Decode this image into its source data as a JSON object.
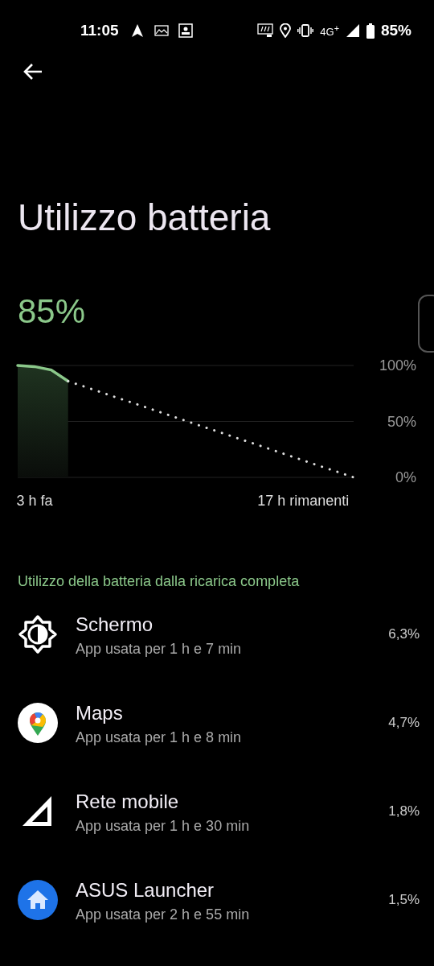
{
  "status_bar": {
    "time": "11:05",
    "network": "4G$^{+}$",
    "battery": "85%"
  },
  "title": "Utilizzo batteria",
  "battery_level": "85%",
  "chart_data": {
    "type": "line",
    "categories": [
      null,
      "3 h fa",
      null,
      null,
      null,
      null,
      null,
      null,
      null,
      null,
      null,
      null,
      null,
      null,
      null,
      null,
      null,
      "17 h rimanenti",
      null,
      null,
      null
    ],
    "series": [
      {
        "color": "#8bc88a",
        "values": [
          100,
          99,
          96,
          86,
          null,
          null,
          null,
          null,
          null,
          null,
          null,
          null,
          null,
          null,
          null,
          null,
          null,
          null,
          null,
          null,
          null
        ]
      },
      {
        "color": "#dddddd",
        "line_style": "dotted",
        "values": [
          null,
          null,
          null,
          86,
          80.9,
          75.9,
          70.8,
          65.8,
          60.7,
          55.6,
          50.6,
          45.5,
          40.5,
          35.4,
          30.4,
          25.3,
          20.2,
          15.2,
          10.1,
          5.1,
          0
        ]
      }
    ],
    "ylim": [
      0,
      100
    ],
    "yticks": [
      {
        "value": 0,
        "label": "0%"
      },
      {
        "value": 50,
        "label": "50%"
      },
      {
        "value": 100,
        "label": "100%"
      }
    ]
  },
  "section_header": "Utilizzo della batteria dalla ricarica completa",
  "apps": [
    {
      "kind": "screen",
      "name": "Schermo",
      "usage": "App usata per 1 h e 7 min",
      "percent": "6,3%"
    },
    {
      "kind": "maps",
      "name": "Maps",
      "usage": "App usata per 1 h e 8 min",
      "percent": "4,7%"
    },
    {
      "kind": "signal",
      "name": "Rete mobile",
      "usage": "App usata per 1 h e 30 min",
      "percent": "1,8%"
    },
    {
      "kind": "launcher",
      "name": "ASUS Launcher",
      "usage": "App usata per 2 h e 55 min",
      "percent": "1,5%"
    }
  ]
}
